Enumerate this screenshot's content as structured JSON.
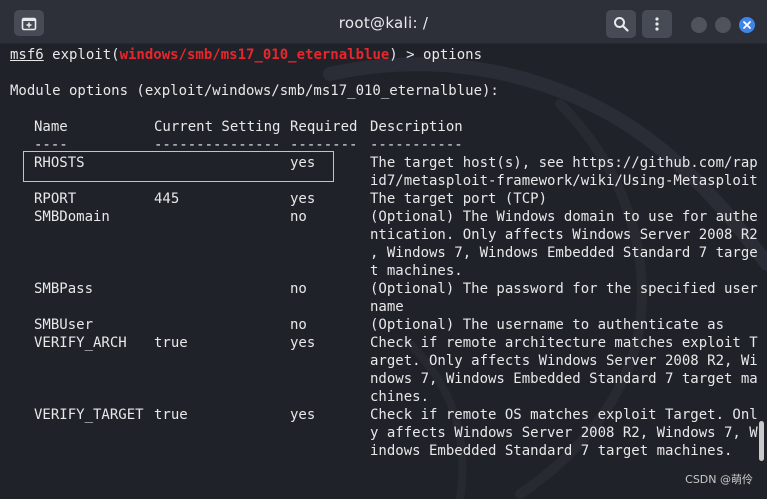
{
  "window": {
    "title": "root@kali: /"
  },
  "terminal": {
    "prompt_name": "msf6",
    "prompt_pre": " exploit(",
    "prompt_module": "windows/smb/ms17_010_eternalblue",
    "prompt_post": ") > options",
    "module_heading": "Module options (exploit/windows/smb/ms17_010_eternalblue):",
    "headers": {
      "name": "Name",
      "current": "Current Setting",
      "required": "Required",
      "description": "Description"
    },
    "separators": {
      "name": "----",
      "current": "---------------",
      "required": "--------",
      "description": "-----------"
    },
    "options": [
      {
        "name": "RHOSTS",
        "current": "",
        "required": "yes",
        "desc": [
          "The target host(s), see https://github.com/rap",
          "id7/metasploit-framework/wiki/Using-Metasploit"
        ]
      },
      {
        "name": "RPORT",
        "current": "445",
        "required": "yes",
        "desc": [
          "The target port (TCP)"
        ]
      },
      {
        "name": "SMBDomain",
        "current": "",
        "required": "no",
        "desc": [
          "(Optional) The Windows domain to use for authe",
          "ntication. Only affects Windows Server 2008 R2",
          ", Windows 7, Windows Embedded Standard 7 targe",
          "t machines."
        ]
      },
      {
        "name": "SMBPass",
        "current": "",
        "required": "no",
        "desc": [
          "(Optional) The password for the specified user",
          "name"
        ]
      },
      {
        "name": "SMBUser",
        "current": "",
        "required": "no",
        "desc": [
          "(Optional) The username to authenticate as"
        ]
      },
      {
        "name": "VERIFY_ARCH",
        "current": "true",
        "required": "yes",
        "desc": [
          "Check if remote architecture matches exploit T",
          "arget. Only affects Windows Server 2008 R2, Wi",
          "ndows 7, Windows Embedded Standard 7 target ma",
          "chines."
        ]
      },
      {
        "name": "VERIFY_TARGET",
        "current": "true",
        "required": "yes",
        "desc": [
          "Check if remote OS matches exploit Target. Onl",
          "y affects Windows Server 2008 R2, Windows 7, W",
          "indows Embedded Standard 7 target machines."
        ]
      }
    ]
  },
  "watermark": "CSDN @萌伶",
  "colors": {
    "background": "#1f2229",
    "titlebar": "#2d3038",
    "module_red": "#e8262b",
    "highlight_yellow": "#d8d532",
    "close_blue": "#3f85e9"
  },
  "icons": {
    "new_tab": "new-tab-icon",
    "search": "search-icon",
    "menu": "kebab-menu-icon",
    "minimize": "minimize-icon",
    "maximize": "maximize-icon",
    "close": "close-icon"
  }
}
